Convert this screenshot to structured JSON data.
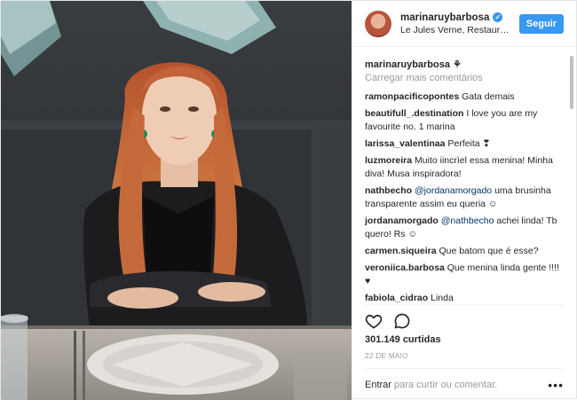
{
  "header": {
    "username": "marinaruybarbosa",
    "verified_glyph": "✓",
    "location": "Le Jules Verne, Restaurant",
    "follow_label": "Seguir"
  },
  "caption": {
    "username": "marinaruybarbosa",
    "text": "⚘"
  },
  "load_more_label": "Carregar mais comentários",
  "comments": [
    {
      "user": "ramonpacificopontes",
      "text": "Gata demais"
    },
    {
      "user": "beautifull_.destination",
      "text": "I love you are my favourite no. 1 marina"
    },
    {
      "user": "larissa_valentinaa",
      "text": "Perfeita ❣"
    },
    {
      "user": "luzmoreira",
      "text": "Muito iincrìel essa menina! Minha diva! Musa inspiradora!"
    },
    {
      "user": "nathbecho",
      "mention": "@jordanamorgado",
      "text": "uma brusinha transparente assim eu queria ☺"
    },
    {
      "user": "jordanamorgado",
      "mention": "@nathbecho",
      "text": "achei linda! Tb quero! Rs ☺"
    },
    {
      "user": "carmen.siqueira",
      "text": "Que batom que é esse?"
    },
    {
      "user": "veroniica.barbosa",
      "text": "Que menina linda gente !!!! ♥"
    },
    {
      "user": "fabiola_cidrao",
      "text": "Linda"
    }
  ],
  "likes_text": "301.149 curtidas",
  "date_text": "22 DE MAIO",
  "add_comment": {
    "link_label": "Entrar",
    "rest": " para curtir ou comentar."
  },
  "more_options_glyph": "•••",
  "icons": {
    "like": "heart-icon",
    "comment": "comment-icon",
    "more": "more-options-icon"
  }
}
